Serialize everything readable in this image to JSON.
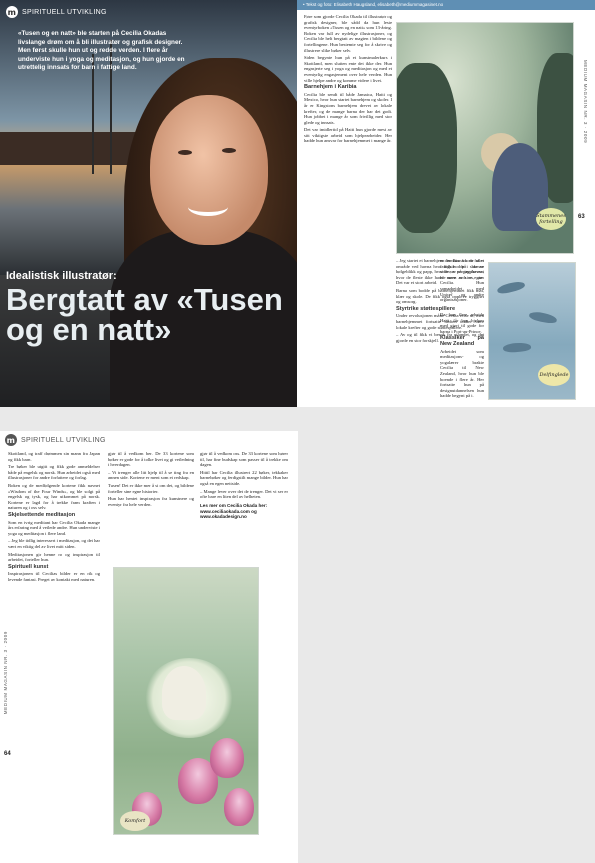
{
  "spread1": {
    "section": "SPIRITUELL UTVIKLING",
    "badge": "m",
    "intro": "«Tusen og en natt» ble starten på Cecilia Okadas livslange drøm om å bli illustratør og grafisk designer. Men først skulle hun ut og redde verden. I flere år underviste hun i yoga og meditasjon, og hun gjorde en utrettelig innsats for barn i fattige land.",
    "kicker": "Idealistisk illustratør:",
    "headline": "Bergtatt av «Tusen og en natt»",
    "credit": "• Tekst og foto: Elisabeth Haugsland, elisabeth@mediummagasinet.no",
    "col1": [
      "Føre som gjorde Cecilia Okada til illustratør og grafisk designer, ble sådd da hun leste eventyrboken «Tusen og en natt» som 13-åring. Boken var full av nydelige illustrasjoner, og Cecilia ble helt bergtatt av magien i bildene og fortellingene. Hun bestemte seg for å skrive og illustrere slike bøker selv.",
      "Siden begynte hun på et kunstmalerkurs i Skottland, men slutten ente det ikke der. Hun engasjerte seg i yoga og meditasjon og med et eventyrlig engasjement over hele verden. Hun ville hjelpe andre og komme videre i livet."
    ],
    "subhead_barnehjem": "Barnehjem i Karibia",
    "col1b": [
      "Cecilia ble sendt til både Jamaica, Haiti og Mexico, hvor hun startet barnehjem og skoler. I år er Kingstons barnehjem drevet av lokale krefter, og de mange barna der har det godt. Hun jobbet i mange år som frivillig med stor glede og innsats.",
      "Det var imidlertid på Haiti hun gjorde mest av sitt viktigste arbeid som hjelpearbeider. Her hadde hun ansvar for barnehjemmet i mange år."
    ],
    "col2": [
      "– Jeg startet et barnehjem der. Barna kom fra et område ved havna hvor folk bodde i skur av bølgeblikk og papp, hvor de var på papphavna, hvor de fleste ikke hadde noen av sine egne. Det var et stort arbeid.",
      "Barna som bodde på barnehjemmet fikk mat, klær og skole. De fikk også oppleve trygghet og omsorg."
    ],
    "subhead_stotte": "Styrtrike støttespillere",
    "col2b": [
      "Under revolusjonen måtte Cecilia reise ut, men barnehjemmet fortsatte driften takket være lokale krefter og gode støttespillere.",
      "– Av og til fikk vi besøk fra utlandet, og det gjorde en stor forskjell."
    ],
    "col3": [
      "en innsats for de aller fattigste på denne siden, er nor jeg foroset er mere noh es, sier Cecilia. Hun samarbeidet med Unicef og andre organisasjoner.",
      "Da hun flere arbeide Haiti, får hun hjelper med gjort til gode for barna i Port-au-Prince."
    ],
    "subhead_klassiker": "Klassiker på New Zealand",
    "col3b": [
      "Arbeidet som meditasjons- og yogalærer brakte Cecilia til New Zealand, hvor hun ble boende i flere år. Her fortsatte hun på designutdannelsen hun hadde begynt på i."
    ],
    "caption1": "Stammenes fortelling",
    "caption2": "Delfinglede",
    "pageno": "63",
    "vertical": "MEDIUM MAGASIN NR. 3 · 2009"
  },
  "page2": {
    "section": "SPIRITUELL UTVIKLING",
    "badge": "m",
    "col1": [
      "Skottland, og traff drømmen sin mann fra Japan og fikk barn.",
      "Tre bøker ble utgitt og fikk gode anmeldelser både på engelsk og norsk. Hun arbeidet også med illustrasjoner for andre forfattere og forlag.",
      "Boken og de medfølgende kortene fikk navnet «Wisdom of the Four Winds», og ble solgt på engelsk og tysk, og har utkommet på norsk. Kortene er lagd for å trekke fram kraften i naturen og i oss selv."
    ],
    "subhead_meditasjon": "Skjelsettende meditasjon",
    "col1b": [
      "Som en ivrig meditant har Cecilia Okada mange års erfaring med å veilede andre. Hun underviste i yoga og meditasjon i flere land.",
      "– Jeg ble tidlig interessert i meditasjon, og det har vært en viktig del av livet mitt siden.",
      "Meditasjonen gir henne ro og inspirasjon til arbeidet, forteller hun."
    ],
    "subhead_kunst": "Spirituell kunst",
    "col1c": [
      "Inspirasjonen til Cecilias bilder er en rik og levende fantasi. Preget av kontakt med naturen."
    ],
    "col2": [
      "gjør til å vedkom ber. De 33 kortene som bøker er gode for å tolke livet og gi veiledning i hverdagen.",
      "– Vi trenger alle litt hjelp til å se ting fra en annen side. Kortene er ment som et redskap.",
      "Tusen! Det er ikke mer å si om det, og bildene forteller sine egne historier.",
      "Hun har hentet inspirasjon fra kunstnere og eventyr fra hele verden."
    ],
    "col3": [
      "gjør til å vedkom oss. De 33 kortene som hører til, har fine budskap som passer til å trekke om dagen.",
      "Hittil har Cecilia illustrert 22 bøker, tekkaker barnebøker og ferdigstilt mange bilder. Hun har også en egen nettside.",
      "– Mange lever over det de trenger. Det vi ser er ofte bare en liten del av helheten."
    ],
    "links_label": "Les mer om Cecilia Okada her:",
    "link1": "www.ceciliaokada.com og",
    "link2": "www.okadadesign.no",
    "caption3": "Komfort",
    "pageno": "64",
    "vertical": "MEDIUM MAGASIN NR. 3 · 2009"
  }
}
